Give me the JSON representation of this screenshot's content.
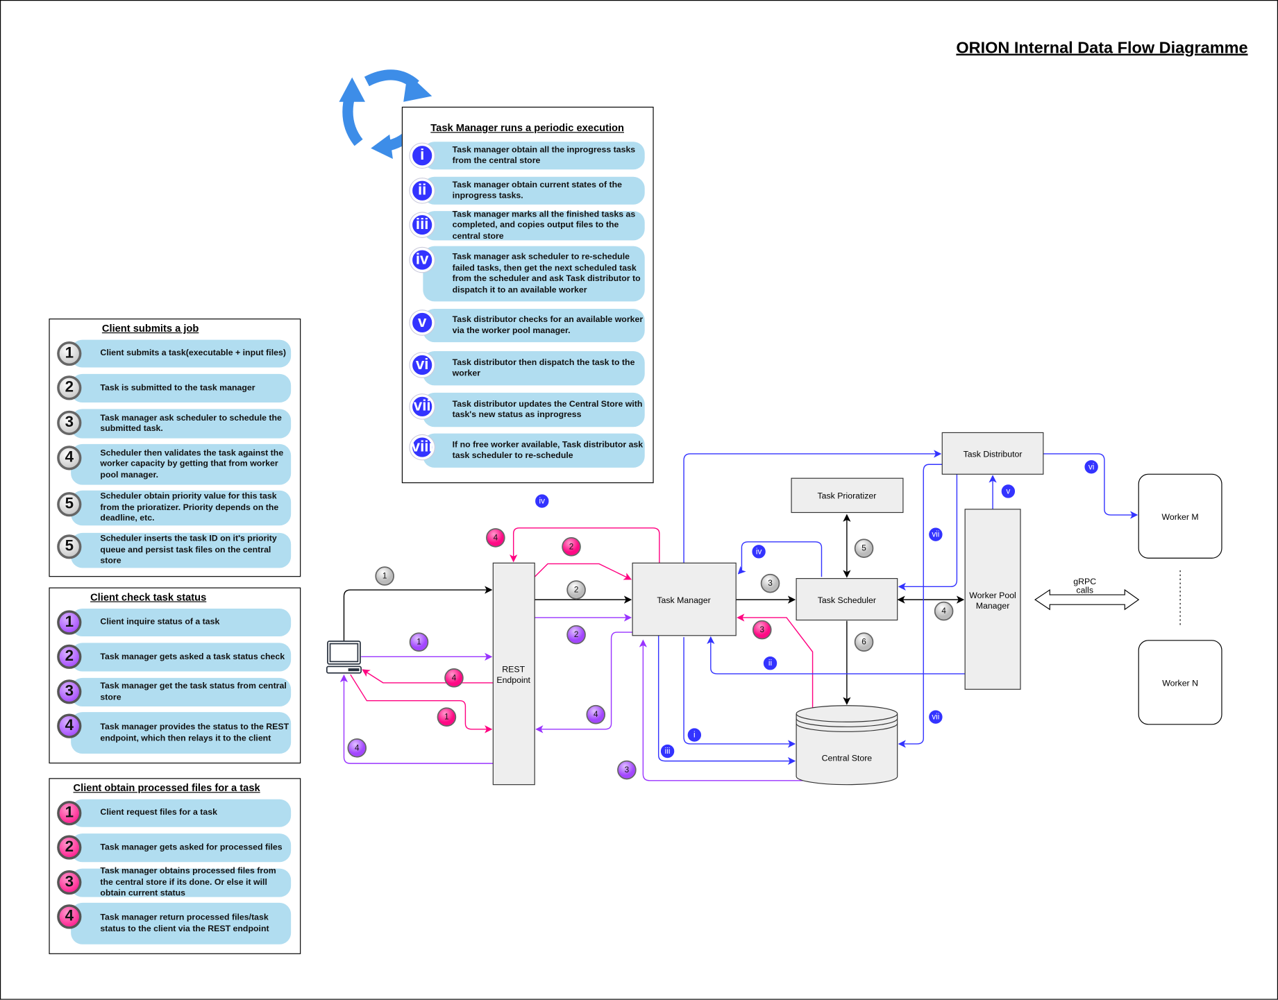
{
  "title": "ORION Internal Data Flow Diagramme",
  "colors": {
    "gray": "#cccccc",
    "purple": "#9933ff",
    "pink": "#ff0080",
    "blue": "#3333ff",
    "pill": "#b1ddf0",
    "cycle": "#3d8de8"
  },
  "panels": [
    {
      "id": "submit",
      "title": "Client submits a job",
      "style": "gray",
      "items": [
        {
          "n": "1",
          "text": "Client submits a task(executable + input files)"
        },
        {
          "n": "2",
          "text": "Task is submitted to the task manager"
        },
        {
          "n": "3",
          "text": "Task manager ask scheduler to schedule the submitted task."
        },
        {
          "n": "4",
          "text": "Scheduler then validates the task against the worker capacity by getting that from worker pool manager."
        },
        {
          "n": "5",
          "text": "Scheduler obtain priority value for this task from the prioratizer. Priority depends on the deadline, etc."
        },
        {
          "n": "5",
          "text": "Scheduler inserts the task ID on it's priority queue and persist task files on the central store"
        }
      ]
    },
    {
      "id": "status",
      "title": "Client check task status",
      "style": "purple",
      "items": [
        {
          "n": "1",
          "text": "Client inquire status of a task"
        },
        {
          "n": "2",
          "text": "Task manager gets asked a task status check"
        },
        {
          "n": "3",
          "text": "Task manager get the task status from central store"
        },
        {
          "n": "4",
          "text": "Task manager provides the status to the REST endpoint, which then relays it to the client"
        }
      ]
    },
    {
      "id": "files",
      "title": "Client obtain processed files for a task",
      "style": "pink",
      "items": [
        {
          "n": "1",
          "text": "Client request files for a task"
        },
        {
          "n": "2",
          "text": "Task manager gets asked for processed files"
        },
        {
          "n": "3",
          "text": "Task manager obtains processed files from the central store if its done. Or else it will obtain current status"
        },
        {
          "n": "4",
          "text": "Task manager return processed files/task status to the client via the REST endpoint"
        }
      ]
    },
    {
      "id": "periodic",
      "title": "Task Manager runs a periodic execution",
      "style": "blue",
      "items": [
        {
          "n": "i",
          "text": "Task manager obtain all the inprogress tasks from the central store"
        },
        {
          "n": "ii",
          "text": "Task manager obtain current states of the inprogress tasks."
        },
        {
          "n": "iii",
          "text": "Task manager marks all the finished tasks as completed, and copies output files to the central store"
        },
        {
          "n": "iv",
          "text": "Task manager ask scheduler to re-schedule failed tasks, then get the next scheduled task from the scheduler and ask Task distributor to dispatch it to an available worker"
        },
        {
          "n": "v",
          "text": "Task distributor checks for an available worker via the  worker pool manager."
        },
        {
          "n": "vi",
          "text": "Task distributor then dispatch the task to the worker"
        },
        {
          "n": "vii",
          "text": "Task distributor updates the Central Store with task's new status as inprogress"
        },
        {
          "n": "viii",
          "text": "If no free worker available, Task distributor ask task scheduler to re-schedule"
        }
      ]
    }
  ],
  "nodes": {
    "rest_1": "REST",
    "rest_2": "Endpoint",
    "task_manager": "Task Manager",
    "task_scheduler": "Task Scheduler",
    "task_prioratizer": "Task Prioratizer",
    "task_distributor": "Task Distributor",
    "worker_pool_1": "Worker Pool",
    "worker_pool_2": "Manager",
    "worker_m": "Worker M",
    "worker_n": "Worker N",
    "central_store": "Central Store",
    "grpc_1": "gRPC",
    "grpc_2": "calls"
  },
  "badges": [
    {
      "label": "1",
      "style": "gray"
    },
    {
      "label": "2",
      "style": "gray"
    },
    {
      "label": "3",
      "style": "gray"
    },
    {
      "label": "4",
      "style": "gray"
    },
    {
      "label": "5",
      "style": "gray"
    },
    {
      "label": "6",
      "style": "gray"
    },
    {
      "label": "1",
      "style": "purple"
    },
    {
      "label": "2",
      "style": "purple"
    },
    {
      "label": "3",
      "style": "purple"
    },
    {
      "label": "4",
      "style": "purple"
    },
    {
      "label": "4",
      "style": "purple"
    },
    {
      "label": "1",
      "style": "pink"
    },
    {
      "label": "2",
      "style": "pink"
    },
    {
      "label": "3",
      "style": "pink"
    },
    {
      "label": "4",
      "style": "pink"
    },
    {
      "label": "4",
      "style": "pink"
    },
    {
      "label": "i",
      "style": "blue"
    },
    {
      "label": "ii",
      "style": "blue"
    },
    {
      "label": "iii",
      "style": "blue"
    },
    {
      "label": "iv",
      "style": "blue"
    },
    {
      "label": "iv",
      "style": "blue"
    },
    {
      "label": "v",
      "style": "blue"
    },
    {
      "label": "vi",
      "style": "blue"
    },
    {
      "label": "vii",
      "style": "blue"
    },
    {
      "label": "vii",
      "style": "blue"
    }
  ]
}
